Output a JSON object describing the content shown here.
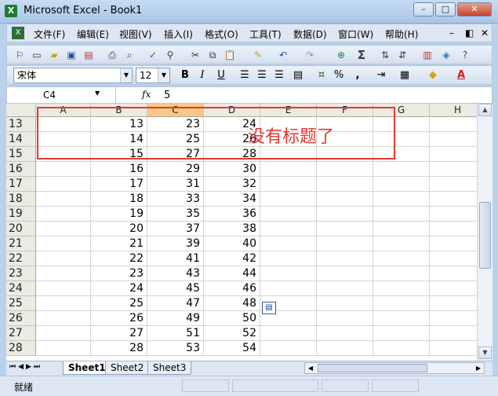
{
  "window": {
    "title": "Microsoft Excel - Book1",
    "icon": "excel-icon",
    "min": "–",
    "max": "□",
    "close": "✕"
  },
  "menu": {
    "icon": "workbook-icon",
    "items": [
      "文件(F)",
      "编辑(E)",
      "视图(V)",
      "插入(I)",
      "格式(O)",
      "工具(T)",
      "数据(D)",
      "窗口(W)",
      "帮助(H)"
    ],
    "doc_min": "–",
    "doc_restore": "◧",
    "doc_close": "✕"
  },
  "toolbar": {
    "icons": [
      "permission-icon",
      "new-icon",
      "open-icon",
      "save-icon",
      "permission-doc-icon",
      "print-icon",
      "print-preview-icon",
      "spelling-icon",
      "research-icon",
      "cut-icon",
      "copy-icon",
      "paste-icon",
      "format-painter-icon",
      "undo-icon",
      "redo-icon",
      "hyperlink-icon",
      "autosum-icon",
      "sort-asc-icon",
      "sort-desc-icon",
      "chart-wizard-icon",
      "drawing-icon",
      "help-icon"
    ],
    "autosum": "Σ"
  },
  "format": {
    "font": "宋体",
    "size": "12",
    "bold": "B",
    "italic": "I",
    "underline": "U",
    "percent": "%",
    "comma": ","
  },
  "formula": {
    "name_box": "C4",
    "fx": "fx",
    "value": "5"
  },
  "grid": {
    "columns": [
      "A",
      "B",
      "C",
      "D",
      "E",
      "F",
      "G",
      "H"
    ],
    "selected_column": "C",
    "rows": [
      {
        "n": "13",
        "b": "13",
        "c": "23",
        "d": "24"
      },
      {
        "n": "14",
        "b": "14",
        "c": "25",
        "d": "26"
      },
      {
        "n": "15",
        "b": "15",
        "c": "27",
        "d": "28"
      },
      {
        "n": "16",
        "b": "16",
        "c": "29",
        "d": "30"
      },
      {
        "n": "17",
        "b": "17",
        "c": "31",
        "d": "32"
      },
      {
        "n": "18",
        "b": "18",
        "c": "33",
        "d": "34"
      },
      {
        "n": "19",
        "b": "19",
        "c": "35",
        "d": "36"
      },
      {
        "n": "20",
        "b": "20",
        "c": "37",
        "d": "38"
      },
      {
        "n": "21",
        "b": "21",
        "c": "39",
        "d": "40"
      },
      {
        "n": "22",
        "b": "22",
        "c": "41",
        "d": "42"
      },
      {
        "n": "23",
        "b": "23",
        "c": "43",
        "d": "44"
      },
      {
        "n": "24",
        "b": "24",
        "c": "45",
        "d": "46"
      },
      {
        "n": "25",
        "b": "25",
        "c": "47",
        "d": "48"
      },
      {
        "n": "26",
        "b": "26",
        "c": "49",
        "d": "50"
      },
      {
        "n": "27",
        "b": "27",
        "c": "51",
        "d": "52"
      },
      {
        "n": "28",
        "b": "28",
        "c": "53",
        "d": "54"
      }
    ]
  },
  "annotation": {
    "text": "没有标题了",
    "color": "#e03a32"
  },
  "sheets": {
    "tabs": [
      "Sheet1",
      "Sheet2",
      "Sheet3"
    ],
    "active": "Sheet1"
  },
  "status": {
    "text": "就绪"
  },
  "colors": {
    "accent": "#1f7a2e",
    "selected_header": "#f9c886"
  }
}
